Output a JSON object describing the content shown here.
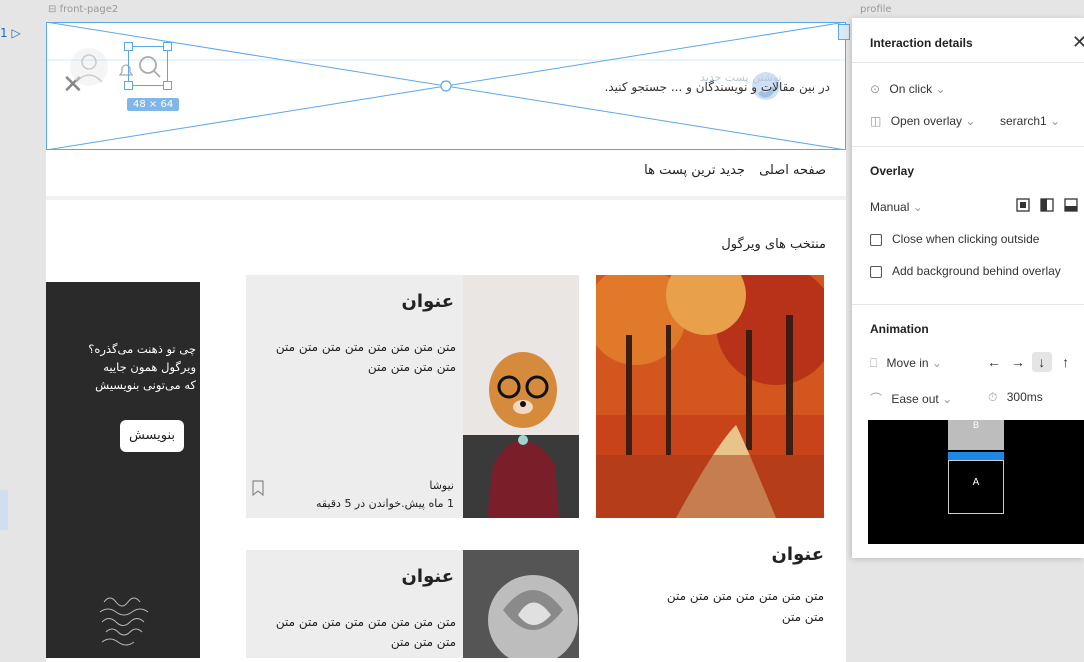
{
  "canvas": {
    "frame_label_left": "front-page2",
    "frame_label_right": "profile",
    "frame_index": "1",
    "size_badge": "48 × 64"
  },
  "header": {
    "search_placeholder": "در بین مقالات و نویسندگان و ... جستجو کنید.",
    "ghost_text": "نوشتن پست جدید",
    "nav_home": "صفحه اصلی",
    "nav_latest": "جدید ترین پست ها"
  },
  "section": {
    "title": "منتخب های ویرگول"
  },
  "promo": {
    "line1": "چی تو ذهنت می‌گذره؟",
    "line2": "ویرگول همون جاییه",
    "line3": "که می‌تونی بنویسیش",
    "button": "بنویسش"
  },
  "cards": [
    {
      "title": "عنوان",
      "body": "متن متن متن متن متن متن متن متن متن متن متن متن",
      "author": "نیوشا",
      "meta": "1 ماه پیش.خواندن در 5 دقیقه"
    },
    {
      "title": "عنوان",
      "body": "متن متن متن متن متن متن متن متن متن متن متن"
    },
    {
      "title": "عنوان",
      "body": "متن متن متن متن متن متن متن متن متن"
    }
  ],
  "panel": {
    "title": "Interaction details",
    "trigger": "On click",
    "action": "Open overlay",
    "destination": "serarch1",
    "overlay_title": "Overlay",
    "position": "Manual",
    "close_outside": "Close when clicking outside",
    "add_background": "Add background behind overlay",
    "animation_title": "Animation",
    "animation_type": "Move in",
    "easing": "Ease out",
    "duration": "300ms",
    "preview_a": "A",
    "preview_b": "B",
    "directions": [
      "←",
      "→",
      "↓",
      "↑"
    ]
  },
  "colors": {
    "selection": "#5aa9e6",
    "accent": "#1e88e5"
  }
}
